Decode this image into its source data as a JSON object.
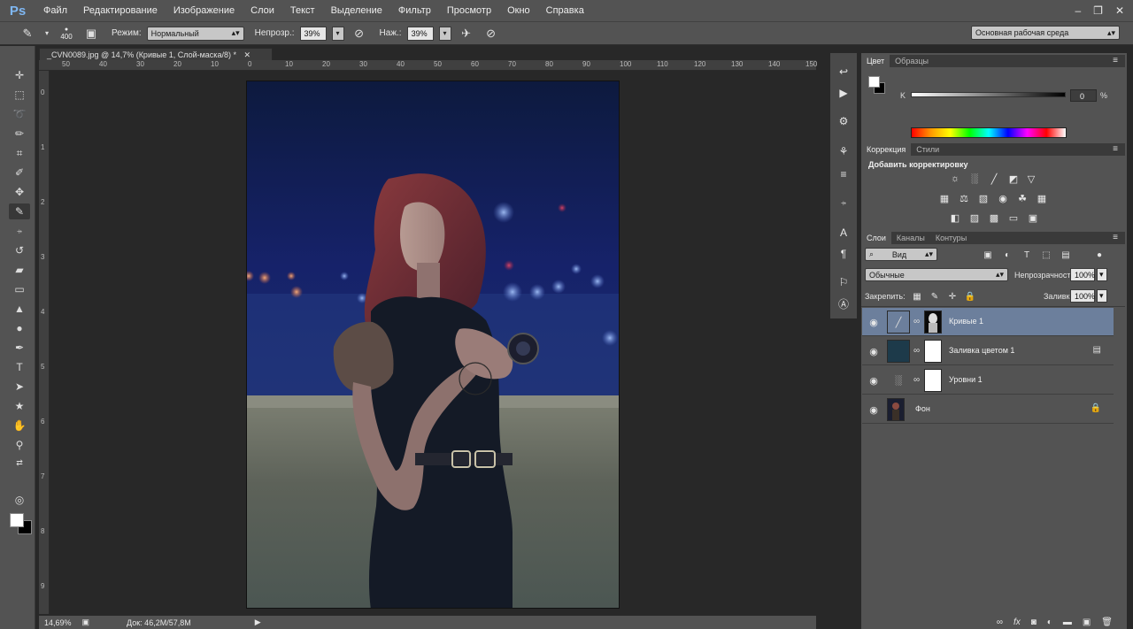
{
  "app": {
    "logo": "Ps"
  },
  "menu": [
    "Файл",
    "Редактирование",
    "Изображение",
    "Слои",
    "Текст",
    "Выделение",
    "Фильтр",
    "Просмотр",
    "Окно",
    "Справка"
  ],
  "options": {
    "brush_size": "400",
    "mode_label": "Режим:",
    "mode_value": "Нормальный",
    "opacity_label": "Непрозр.:",
    "opacity_value": "39%",
    "flow_label": "Наж.:",
    "flow_value": "39%",
    "workspace": "Основная рабочая среда"
  },
  "document": {
    "tab_title": "_CVN0089.jpg @ 14,7% (Кривые 1, Слой-маска/8) *",
    "ruler_h": [
      "50",
      "40",
      "30",
      "20",
      "10",
      "0",
      "10",
      "20",
      "30",
      "40",
      "50",
      "60",
      "70",
      "80",
      "90",
      "100",
      "110",
      "120",
      "130",
      "140",
      "150"
    ],
    "ruler_v": [
      "0",
      "1",
      "2",
      "3",
      "4",
      "5",
      "6",
      "7",
      "8",
      "9"
    ],
    "zoom": "14,69%",
    "doc_size": "Док: 46,2M/57,8M"
  },
  "color_panel": {
    "tabs": [
      "Цвет",
      "Образцы"
    ],
    "k_label": "K",
    "k_value": "0",
    "k_unit": "%",
    "foreground": "#ffffff",
    "background": "#000000"
  },
  "corrections_panel": {
    "tabs": [
      "Коррекция",
      "Стили"
    ],
    "heading": "Добавить корректировку"
  },
  "layers_panel": {
    "tabs": [
      "Слои",
      "Каналы",
      "Контуры"
    ],
    "filter_kind": "Вид",
    "blend_mode": "Обычные",
    "opacity_label": "Непрозрачность:",
    "opacity_value": "100%",
    "lock_label": "Закрепить:",
    "fill_label": "Заливка:",
    "fill_value": "100%",
    "layers": [
      {
        "name": "Кривые 1",
        "selected": true
      },
      {
        "name": "Заливка цветом 1",
        "selected": false
      },
      {
        "name": "Уровни 1",
        "selected": false
      },
      {
        "name": "Фон",
        "selected": false
      }
    ]
  },
  "colors": {
    "chrome": "#535353",
    "canvas_bg": "#282828",
    "selection": "#6c7f9c",
    "photo_sky": "#141a4a",
    "photo_fill_swatch": "#1d3a4a"
  }
}
